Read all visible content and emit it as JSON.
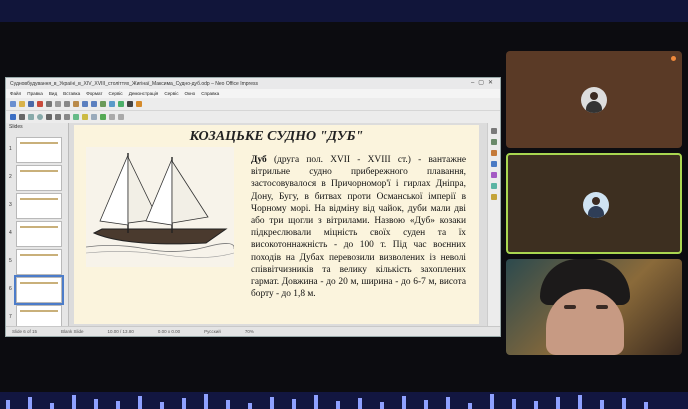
{
  "window": {
    "title": "Судновбудування_в_Україні_в_XIV_XVIII_століттях_Жигінаї_Максима_Судно-дуб.odp – Neo Office Impress",
    "menu": [
      "Файл",
      "Правка",
      "Вид",
      "Вставка",
      "Формат",
      "Сервіс",
      "Демонстрація",
      "Сервіс",
      "Окно",
      "Справка"
    ]
  },
  "slides_panel": {
    "header": "Slides",
    "thumbnails": [
      "1",
      "2",
      "3",
      "4",
      "5",
      "6",
      "7"
    ],
    "selected": "6"
  },
  "slide": {
    "title": "КОЗАЦЬКЕ СУДНО \"ДУБ\"",
    "lead": "Дуб",
    "body": " (друга пол. XVII - XVIII ст.) - вантажне вітрильне судно прибережного плавання, застосовувалося в Причорномор'ї і гирлах Дніпра, Дону, Бугу, в битвах проти Османської імперії в Чорному морі. На відміну від чайок, дуби мали дві або три щогли з вітрилами. Назвою «Дуб» козаки підкреслювали міцність своїх суден та їх високотоннажність - до 100 т. Під час воєнних походів на Дубах перевозили визволених із неволі співвітчизників та велику кількість захоплених гармат. Довжина - до 20 м, ширина - до 6-7 м, висота борту - до 1,8 м."
  },
  "statusbar": {
    "items": [
      "Slide 6 of 15",
      "Blank Slide",
      "10.00 / 13.80",
      "0.00 x 0.00",
      "Русский",
      "70%"
    ]
  },
  "icons": {
    "tile_avatar": "person-avatar-icon",
    "mic": "mic-active-icon"
  },
  "colors": {
    "active_speaker_border": "#a9d650",
    "accent": "#4c7cc9"
  }
}
